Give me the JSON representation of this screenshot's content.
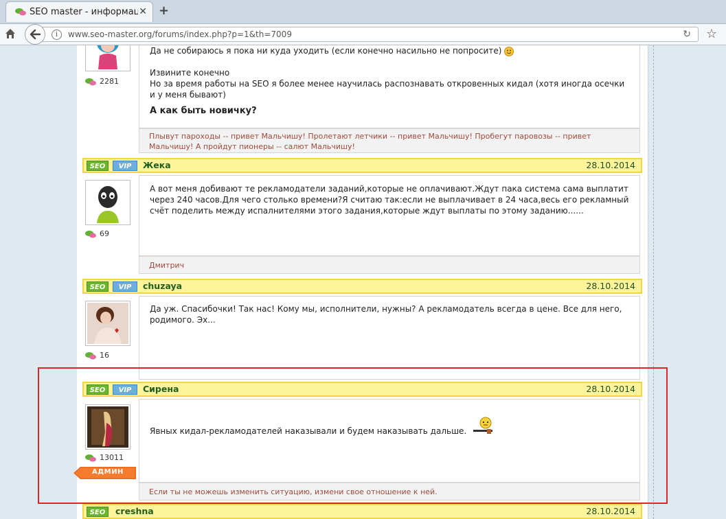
{
  "browser": {
    "tab_title": "SEO master - информаци...",
    "url": "www.seo-master.org/forums/index.php?p=1&th=7009"
  },
  "posts": [
    {
      "rating": "2281",
      "lines": [
        "Да не собираюсь я пока ни куда уходить (если конечно насильно не попросите)",
        "",
        "Извините конечно",
        "Но за время работы на SEO я более менее научилась распознавать откровенных кидал (хотя иногда осечки и у меня бывают)"
      ],
      "bold": "А как быть новичку?",
      "signature": "Плывут пароходы -- привет Мальчишу! Пролетают летчики -- привет Мальчишу! Пробегут паровозы -- привет Мальчишу! А пройдут пионеры -- салют Мальчишу!"
    },
    {
      "badges": [
        "SEO",
        "VIP"
      ],
      "username": "Жека",
      "date": "28.10.2014",
      "rating": "69",
      "text": "А вот меня добивают те рекламодатели заданий,которые не оплачивают.Ждут пака система сама выплатит через 240 часов.Для чего столько времени?Я считаю так:если не выплачивает в 24 часа,весь его рекламный счёт поделить между испалнителями этого задания,которые ждут выплаты по этому заданию......",
      "signature": "Дмитрич"
    },
    {
      "badges": [
        "SEO",
        "VIP"
      ],
      "username": "chuzaya",
      "date": "28.10.2014",
      "rating": "16",
      "text": "Да уж. Спасибочки! Так нас! Кому мы, исполнители, нужны? А рекламодатель всегда в цене. Все для него, родимого. Эх..."
    },
    {
      "badges": [
        "SEO",
        "VIP"
      ],
      "username": "Сирена",
      "date": "28.10.2014",
      "rating": "13011",
      "role": "АДМИН",
      "text": "Явных кидал-рекламодателей наказывали и будем наказывать дальше.",
      "signature": "Если ты не можешь изменить ситуацию, измени свое отношение к ней."
    },
    {
      "badges": [
        "SEO"
      ],
      "username": "creshna",
      "date": "28.10.2014"
    }
  ]
}
